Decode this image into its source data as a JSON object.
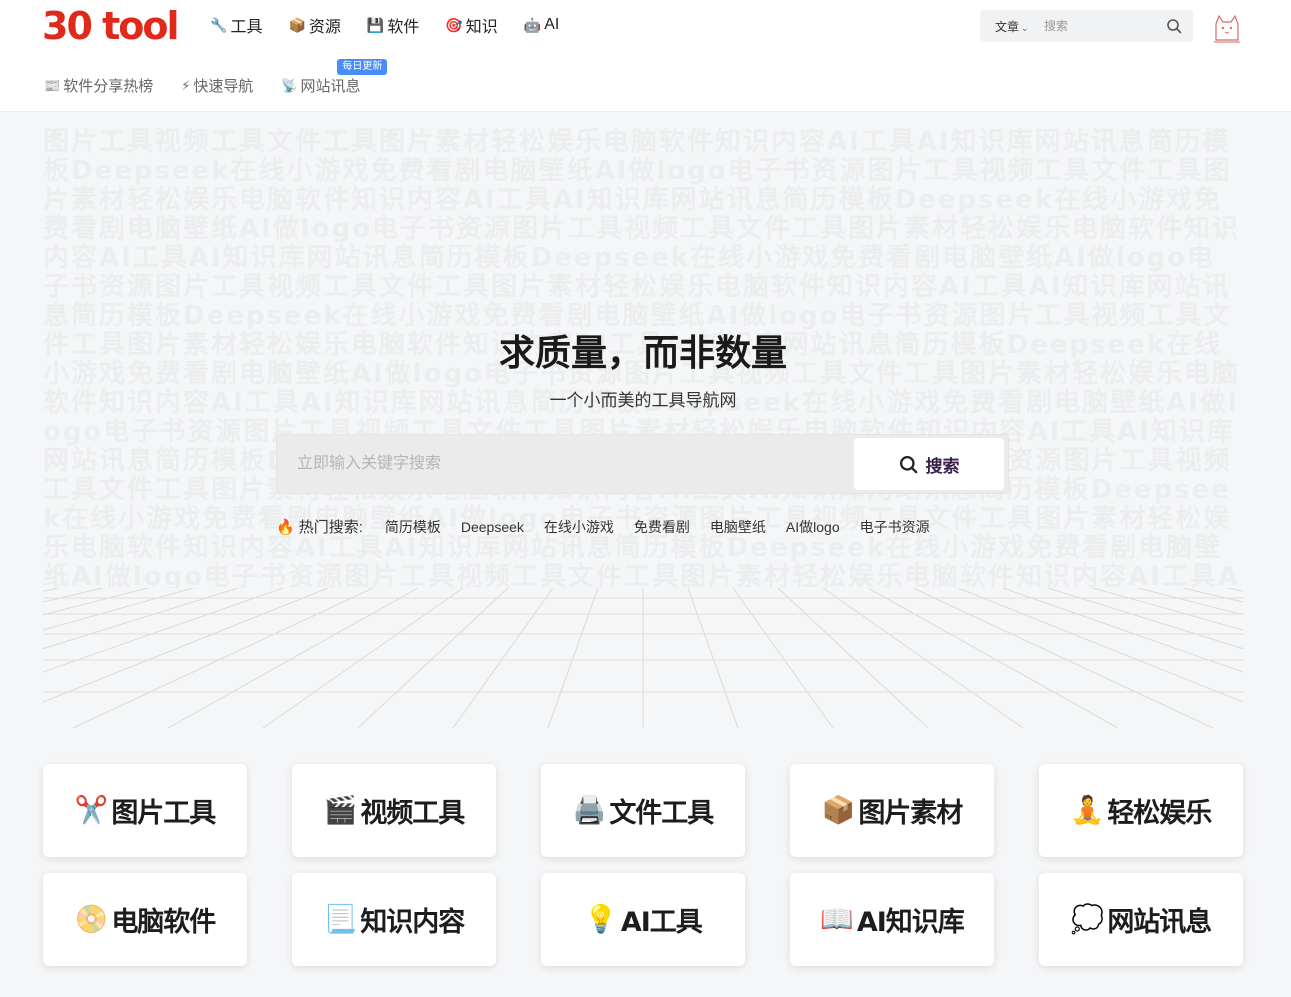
{
  "header": {
    "logo": "30 tool",
    "nav": [
      {
        "icon": "🔧",
        "icon_name": "wrench-icon",
        "label": "工具"
      },
      {
        "icon": "📦",
        "icon_name": "package-icon",
        "label": "资源"
      },
      {
        "icon": "💾",
        "icon_name": "floppy-disk-icon",
        "label": "软件"
      },
      {
        "icon": "🎯",
        "icon_name": "target-icon",
        "label": "知识"
      },
      {
        "icon": "🤖",
        "icon_name": "robot-icon",
        "label": "AI"
      }
    ],
    "search": {
      "category": "文章",
      "placeholder": "搜索"
    },
    "subnav": [
      {
        "icon": "📰",
        "icon_name": "newspaper-icon",
        "label": "软件分享热榜"
      },
      {
        "icon": "⚡",
        "icon_name": "lightning-icon",
        "label": "快速导航"
      },
      {
        "icon": "📡",
        "icon_name": "satellite-icon",
        "label": "网站讯息",
        "badge": "每日更新"
      }
    ]
  },
  "hero": {
    "title": "求质量，而非数量",
    "subtitle": "一个小而美的工具导航网",
    "search_placeholder": "立即输入关键字搜索",
    "search_button": "搜索",
    "hot_label": "热门搜索:",
    "hot_tags": [
      "简历模板",
      "Deepseek",
      "在线小游戏",
      "免费看剧",
      "电脑壁纸",
      "AI做logo",
      "电子书资源"
    ]
  },
  "cards": [
    {
      "icon": "✂️",
      "icon_name": "scissors-icon",
      "label": "图片工具"
    },
    {
      "icon": "🎬",
      "icon_name": "clapperboard-icon",
      "label": "视频工具"
    },
    {
      "icon": "🖨️",
      "icon_name": "printer-icon",
      "label": "文件工具"
    },
    {
      "icon": "📦",
      "icon_name": "box-icon",
      "label": "图片素材"
    },
    {
      "icon": "🧘",
      "icon_name": "meditation-icon",
      "label": "轻松娱乐"
    },
    {
      "icon": "📀",
      "icon_name": "disc-icon",
      "label": "电脑软件"
    },
    {
      "icon": "📃",
      "icon_name": "document-icon",
      "label": "知识内容"
    },
    {
      "icon": "💡",
      "icon_name": "lightbulb-icon",
      "label": "AI工具"
    },
    {
      "icon": "📖",
      "icon_name": "open-book-icon",
      "label": "AI知识库"
    },
    {
      "icon": "💭",
      "icon_name": "thought-bubble-icon",
      "label": "网站讯息"
    }
  ],
  "colors": {
    "brand": "#e0281b",
    "badge": "#4b8df8",
    "flame": "#ff4a1c"
  }
}
